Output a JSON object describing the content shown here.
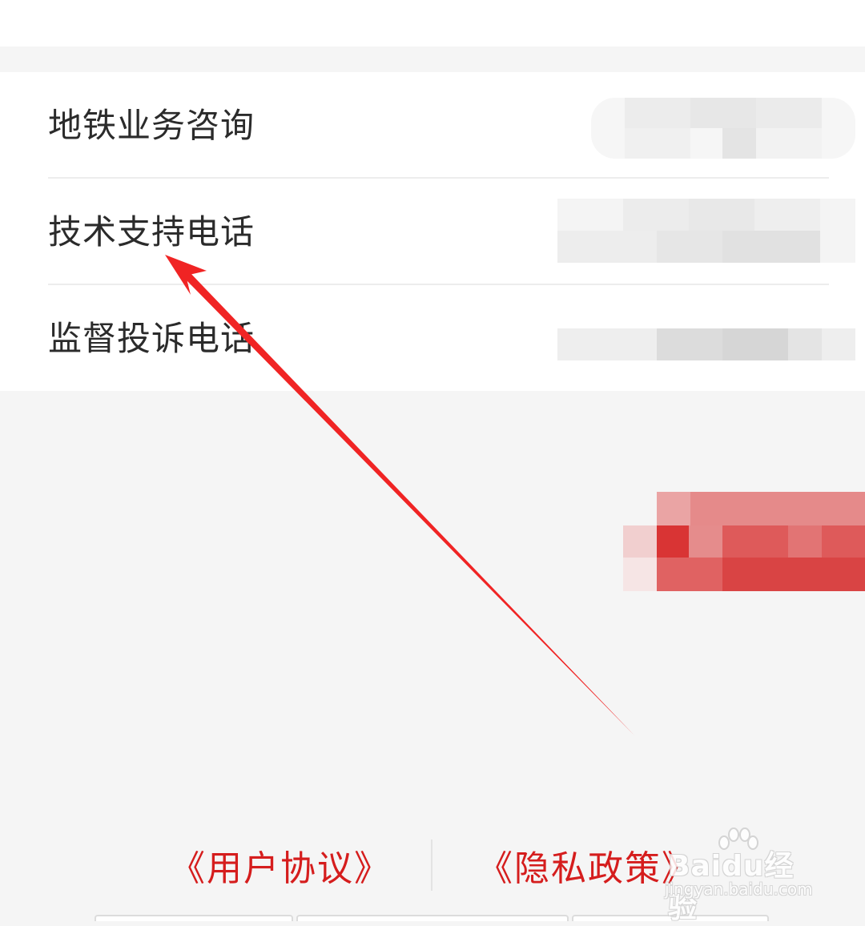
{
  "contacts": {
    "items": [
      {
        "label": "地铁业务咨询"
      },
      {
        "label": "技术支持电话"
      },
      {
        "label": "监督投诉电话"
      }
    ]
  },
  "links": {
    "user_agreement": "《用户协议》",
    "privacy_policy": "《隐私政策》"
  },
  "watermark": {
    "brand": "Baidu经验",
    "url": "jingyan.baidu.com"
  },
  "colors": {
    "link": "#d51d1d",
    "annotation_arrow": "#f02424",
    "redacted_button": "#e05a5a"
  }
}
